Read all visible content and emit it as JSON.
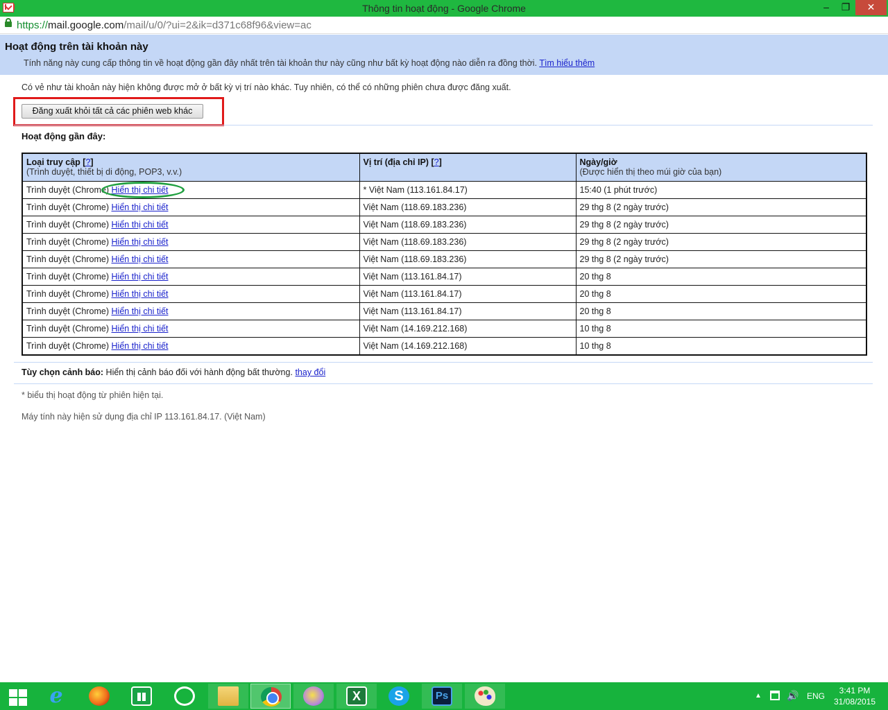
{
  "window": {
    "title": "Thông tin hoạt động - Google Chrome",
    "minimize": "–",
    "maximize": "❐",
    "close": "✕"
  },
  "address": {
    "scheme": "https://",
    "host": "mail.google.com",
    "path": "/mail/u/0/?ui=2&ik=d371c68f96&view=ac"
  },
  "header": {
    "title": "Hoạt động trên tài khoản này",
    "description": "Tính năng này cung cấp thông tin về hoạt động gần đây nhất trên tài khoản thư này cũng như bất kỳ hoạt động nào diễn ra đồng thời.",
    "learn_more": "Tìm hiểu thêm"
  },
  "notice": "Có vẻ như tài khoản này hiện không được mở ở bất kỳ vị trí nào khác. Tuy nhiên, có thể có những phiên chưa được đăng xuất.",
  "signout_button": "Đăng xuất khỏi tất cả các phiên web khác",
  "recent_title": "Hoạt động gần đây:",
  "table": {
    "headers": {
      "access_type": "Loại truy cập",
      "access_type_sub": "(Trình duyệt, thiết bị di động, POP3, v.v.)",
      "location": "Vị trí (địa chỉ IP)",
      "datetime": "Ngày/giờ",
      "datetime_sub": "(Được hiển thị theo múi giờ của bạn)",
      "help_open": "[",
      "help_link": "?",
      "help_close": "]"
    },
    "rows": [
      {
        "access": "Trình duyệt (Chrome)",
        "details": "Hiển thị chi tiết",
        "location": "* Việt Nam (113.161.84.17)",
        "time": "15:40 (1 phút trước)"
      },
      {
        "access": "Trình duyệt (Chrome)",
        "details": "Hiển thị chi tiết",
        "location": "Việt Nam (118.69.183.236)",
        "time": "29 thg 8 (2 ngày trước)"
      },
      {
        "access": "Trình duyệt (Chrome)",
        "details": "Hiển thị chi tiết",
        "location": "Việt Nam (118.69.183.236)",
        "time": "29 thg 8 (2 ngày trước)"
      },
      {
        "access": "Trình duyệt (Chrome)",
        "details": "Hiển thị chi tiết",
        "location": "Việt Nam (118.69.183.236)",
        "time": "29 thg 8 (2 ngày trước)"
      },
      {
        "access": "Trình duyệt (Chrome)",
        "details": "Hiển thị chi tiết",
        "location": "Việt Nam (118.69.183.236)",
        "time": "29 thg 8 (2 ngày trước)"
      },
      {
        "access": "Trình duyệt (Chrome)",
        "details": "Hiển thị chi tiết",
        "location": "Việt Nam (113.161.84.17)",
        "time": "20 thg 8"
      },
      {
        "access": "Trình duyệt (Chrome)",
        "details": "Hiển thị chi tiết",
        "location": "Việt Nam (113.161.84.17)",
        "time": "20 thg 8"
      },
      {
        "access": "Trình duyệt (Chrome)",
        "details": "Hiển thị chi tiết",
        "location": "Việt Nam (113.161.84.17)",
        "time": "20 thg 8"
      },
      {
        "access": "Trình duyệt (Chrome)",
        "details": "Hiển thị chi tiết",
        "location": "Việt Nam (14.169.212.168)",
        "time": "10 thg 8"
      },
      {
        "access": "Trình duyệt (Chrome)",
        "details": "Hiển thị chi tiết",
        "location": "Việt Nam (14.169.212.168)",
        "time": "10 thg 8"
      }
    ]
  },
  "alert": {
    "label": "Tùy chọn cảnh báo:",
    "text": "Hiển thị cảnh báo đối với hành động bất thường.",
    "change": "thay đổi"
  },
  "footnote": "* biểu thị hoạt động từ phiên hiện tại.",
  "ip_note": "Máy tính này hiện sử dụng địa chỉ IP 113.161.84.17. (Việt Nam)",
  "taskbar": {
    "icons": [
      "windows-start-icon",
      "internet-explorer-icon",
      "firefox-icon",
      "windows-store-icon",
      "garena-icon",
      "file-explorer-icon",
      "chrome-icon",
      "yahoo-messenger-icon",
      "excel-icon",
      "skype-icon",
      "photoshop-icon",
      "paint-icon"
    ],
    "excel_glyph": "X",
    "skype_glyph": "S",
    "ps_glyph": "Ps",
    "ie_glyph": "e",
    "tray_arrow": "▲",
    "volume_glyph": "🔊",
    "language": "ENG",
    "time": "3:41 PM",
    "date": "31/08/2015"
  },
  "colors": {
    "titlebar": "#1fb840",
    "header_bg": "#c4d7f6",
    "link": "#1a22cc",
    "highlight_box": "#e01a1a",
    "highlight_oval": "#20a040"
  }
}
